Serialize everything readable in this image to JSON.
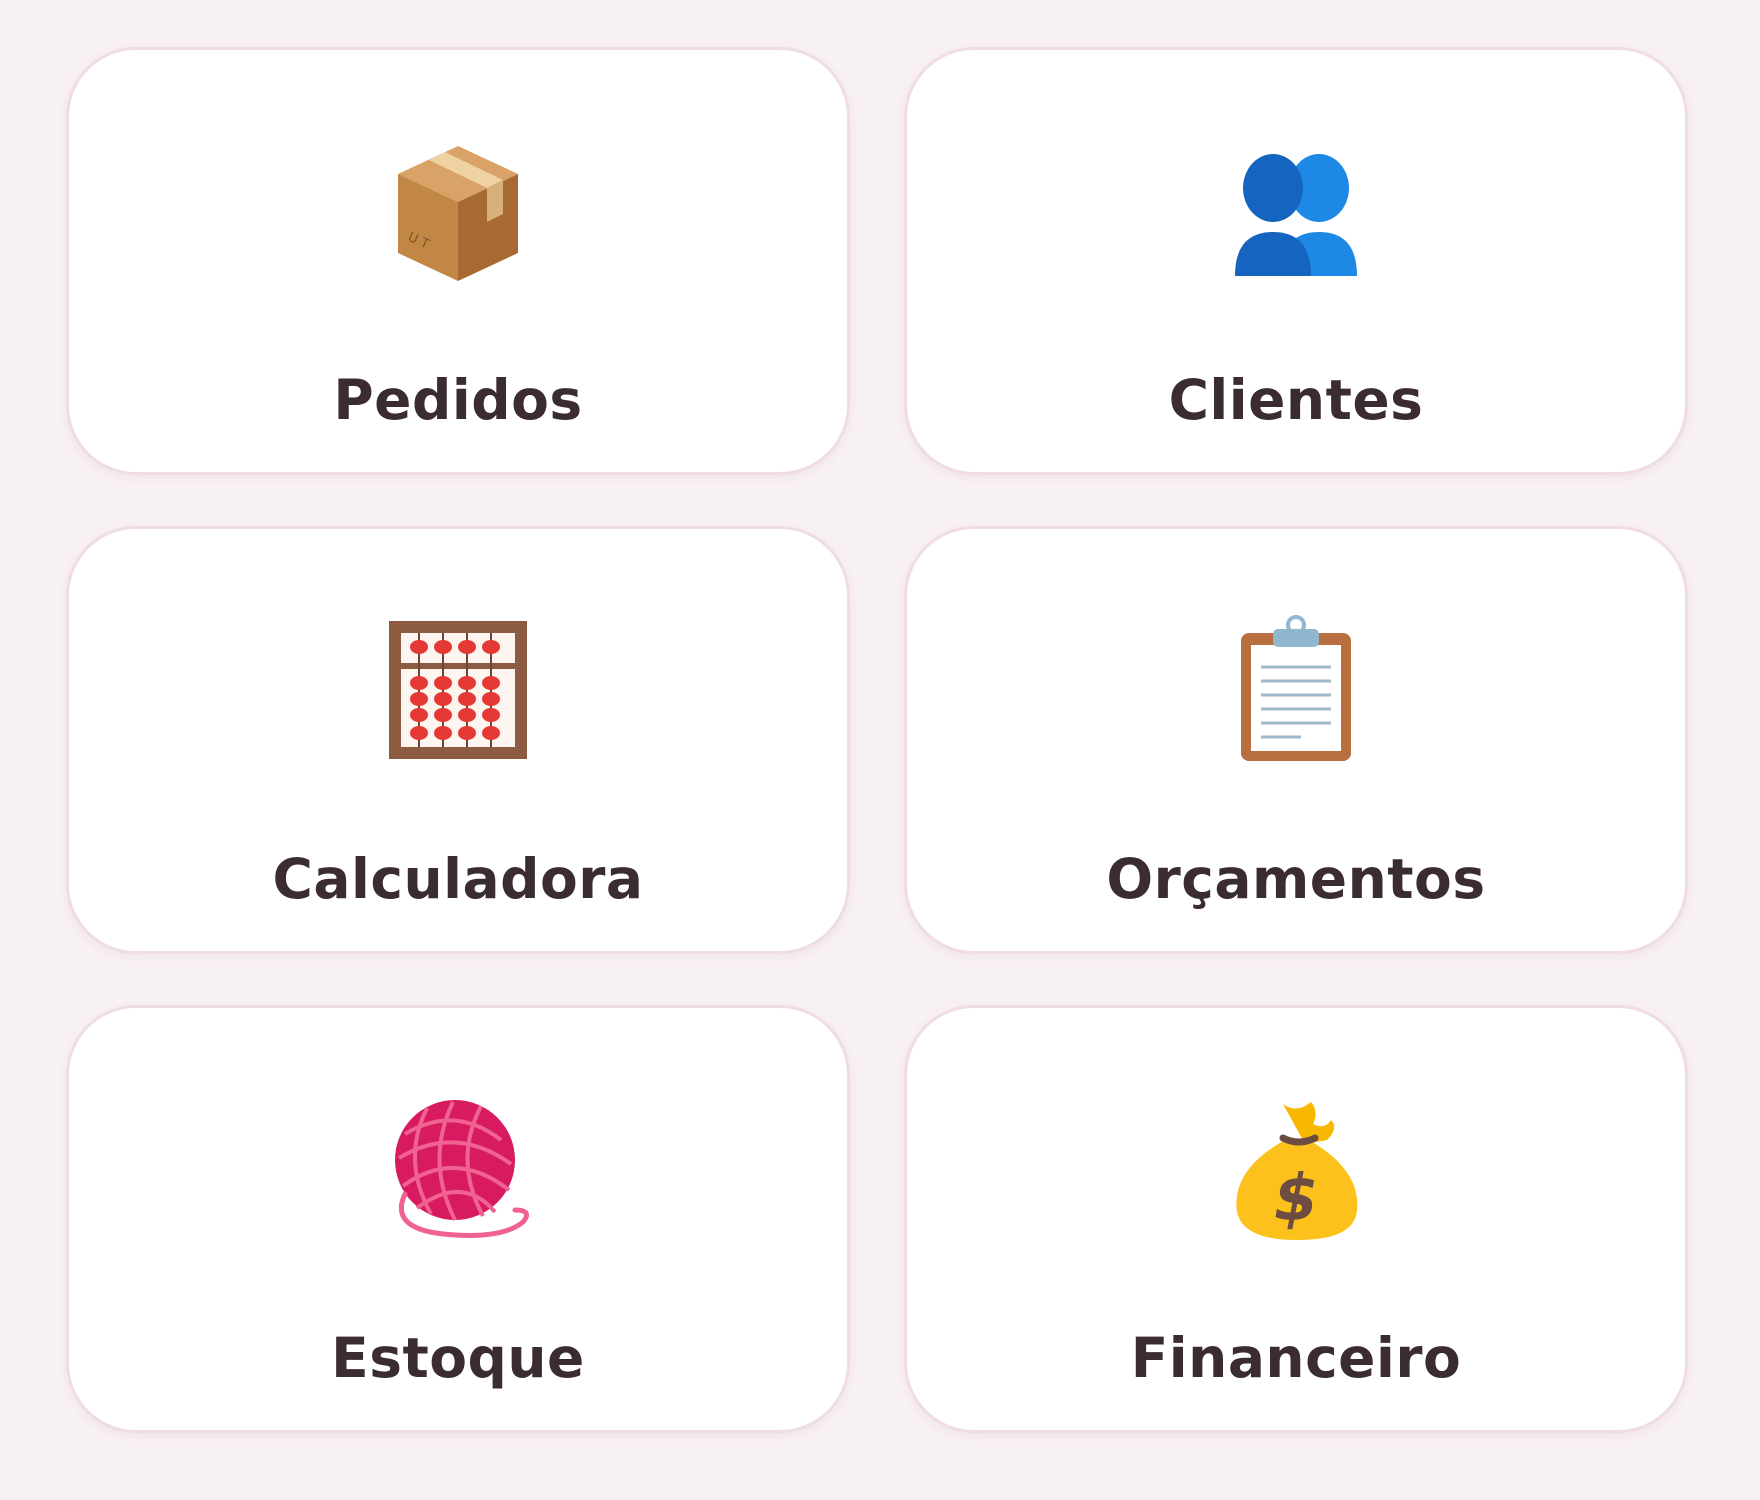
{
  "menu": {
    "items": [
      {
        "label": "Pedidos",
        "icon": "package-icon"
      },
      {
        "label": "Clientes",
        "icon": "users-icon"
      },
      {
        "label": "Calculadora",
        "icon": "abacus-icon"
      },
      {
        "label": "Orçamentos",
        "icon": "clipboard-icon"
      },
      {
        "label": "Estoque",
        "icon": "yarn-icon"
      },
      {
        "label": "Financeiro",
        "icon": "money-bag-icon"
      }
    ]
  },
  "colors": {
    "background": "#f8f1f3",
    "card": "#ffffff",
    "card_border": "#f0dde3",
    "label_text": "#3a2c31"
  }
}
